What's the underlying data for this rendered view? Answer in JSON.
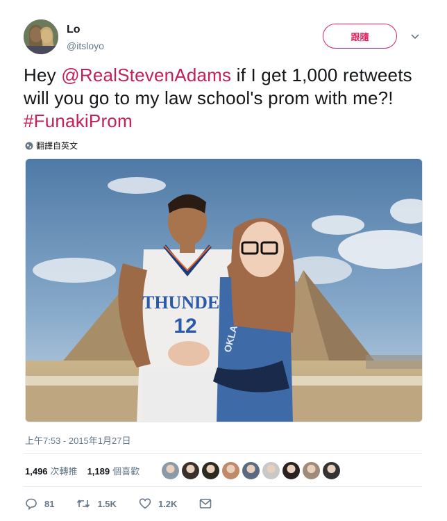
{
  "user": {
    "name": "Lo",
    "handle": "@itsloyo",
    "follow_label": "跟隨",
    "avatar_icon": "profile-photo"
  },
  "tweet": {
    "text_before": "Hey ",
    "mention": "@RealStevenAdams",
    "text_middle": " if I get 1,000 retweets will you go to my law school's prom with me?! ",
    "hashtag": "#FunakiProm",
    "translate_label": "翻譯自英文",
    "timestamp": "上午7:53 - 2015年1月27日"
  },
  "photo": {
    "jersey_text": "THUNDER",
    "jersey_number": "12"
  },
  "stats": {
    "retweets_count": "1,496",
    "retweets_label": "次轉推",
    "likes_count": "1,189",
    "likes_label": "個喜歡",
    "liker_avatars": [
      "#8a9aa8",
      "#3a2f2a",
      "#2d2a20",
      "#c08a6a",
      "#5a6a80",
      "#c8c8c8",
      "#2a2220",
      "#a08a7a",
      "#333333"
    ]
  },
  "actions": {
    "reply_count": "81",
    "retweet_count": "1.5K",
    "like_count": "1.2K"
  },
  "colors": {
    "accent": "#e0245e",
    "link": "#c41f5a",
    "muted": "#657786"
  }
}
